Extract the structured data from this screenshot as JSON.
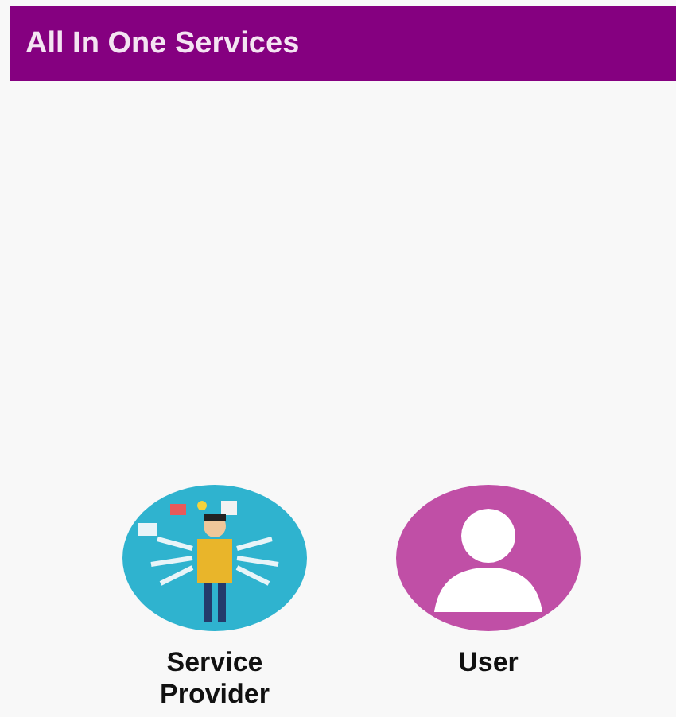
{
  "app_bar": {
    "title": "All In One Services"
  },
  "options": [
    {
      "kind": "illustration",
      "label": "Service Provider"
    },
    {
      "kind": "avatar",
      "label": "User"
    }
  ]
}
